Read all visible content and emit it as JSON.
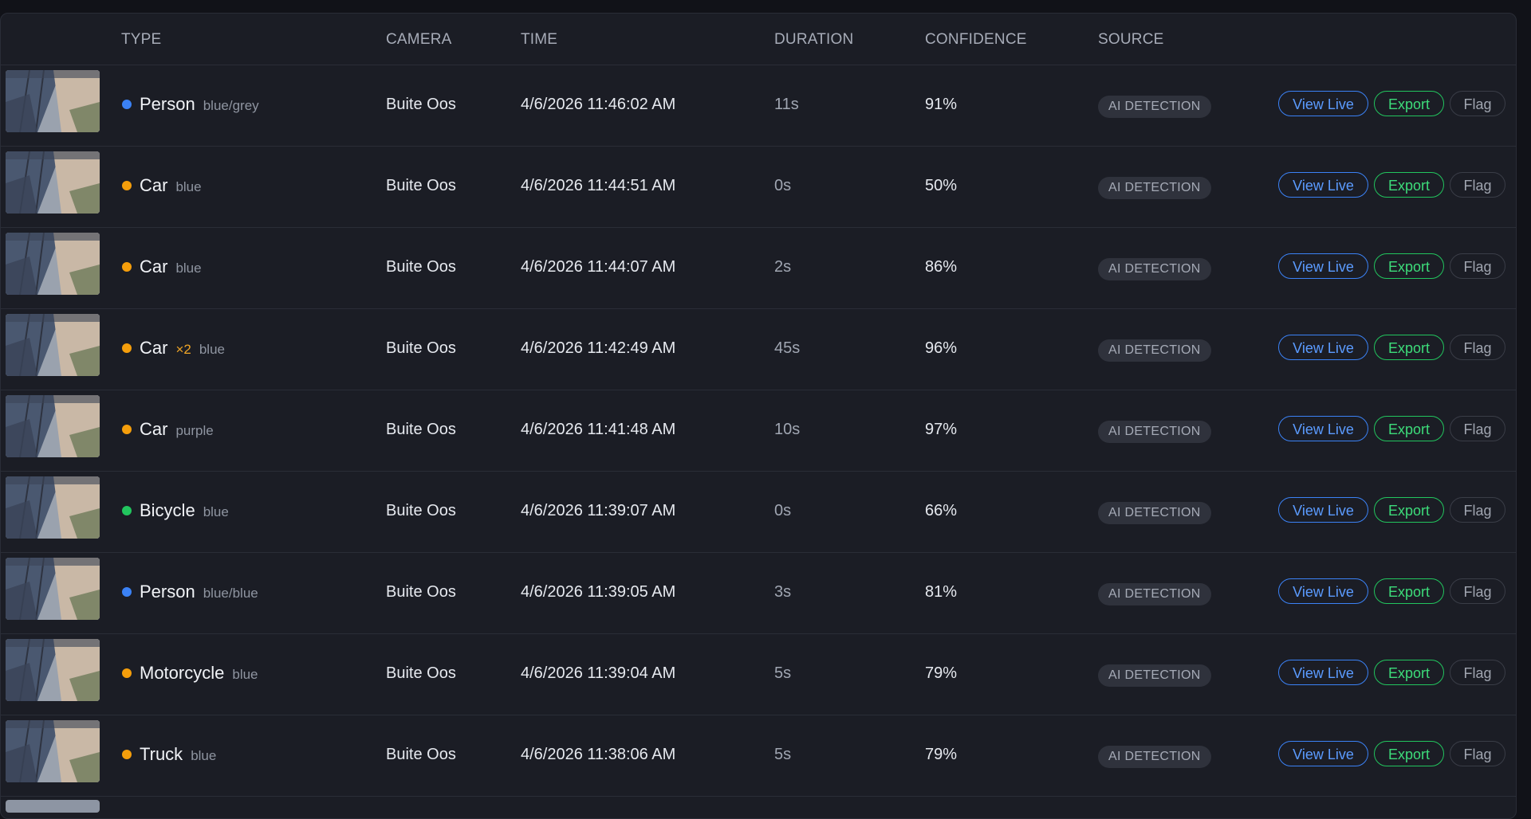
{
  "headers": {
    "type": "TYPE",
    "camera": "CAMERA",
    "time": "TIME",
    "duration": "DURATION",
    "confidence": "CONFIDENCE",
    "source": "SOURCE"
  },
  "colors": {
    "person": "#3b82f6",
    "vehicle": "#f59e0b",
    "bicycle": "#22c55e"
  },
  "rows": [
    {
      "type": "Person",
      "multiplier": "",
      "attr": "blue/grey",
      "dot_color": "#3b82f6",
      "camera": "Buite Oos",
      "time": "4/6/2026 11:46:02 AM",
      "duration": "11s",
      "confidence": "91%",
      "source": "AI DETECTION",
      "view_live": "View Live",
      "export": "Export",
      "flag": "Flag"
    },
    {
      "type": "Car",
      "multiplier": "",
      "attr": "blue",
      "dot_color": "#f59e0b",
      "camera": "Buite Oos",
      "time": "4/6/2026 11:44:51 AM",
      "duration": "0s",
      "confidence": "50%",
      "source": "AI DETECTION",
      "view_live": "View Live",
      "export": "Export",
      "flag": "Flag"
    },
    {
      "type": "Car",
      "multiplier": "",
      "attr": "blue",
      "dot_color": "#f59e0b",
      "camera": "Buite Oos",
      "time": "4/6/2026 11:44:07 AM",
      "duration": "2s",
      "confidence": "86%",
      "source": "AI DETECTION",
      "view_live": "View Live",
      "export": "Export",
      "flag": "Flag"
    },
    {
      "type": "Car",
      "multiplier": "×2",
      "attr": "blue",
      "dot_color": "#f59e0b",
      "camera": "Buite Oos",
      "time": "4/6/2026 11:42:49 AM",
      "duration": "45s",
      "confidence": "96%",
      "source": "AI DETECTION",
      "view_live": "View Live",
      "export": "Export",
      "flag": "Flag"
    },
    {
      "type": "Car",
      "multiplier": "",
      "attr": "purple",
      "dot_color": "#f59e0b",
      "camera": "Buite Oos",
      "time": "4/6/2026 11:41:48 AM",
      "duration": "10s",
      "confidence": "97%",
      "source": "AI DETECTION",
      "view_live": "View Live",
      "export": "Export",
      "flag": "Flag"
    },
    {
      "type": "Bicycle",
      "multiplier": "",
      "attr": "blue",
      "dot_color": "#22c55e",
      "camera": "Buite Oos",
      "time": "4/6/2026 11:39:07 AM",
      "duration": "0s",
      "confidence": "66%",
      "source": "AI DETECTION",
      "view_live": "View Live",
      "export": "Export",
      "flag": "Flag"
    },
    {
      "type": "Person",
      "multiplier": "",
      "attr": "blue/blue",
      "dot_color": "#3b82f6",
      "camera": "Buite Oos",
      "time": "4/6/2026 11:39:05 AM",
      "duration": "3s",
      "confidence": "81%",
      "source": "AI DETECTION",
      "view_live": "View Live",
      "export": "Export",
      "flag": "Flag"
    },
    {
      "type": "Motorcycle",
      "multiplier": "",
      "attr": "blue",
      "dot_color": "#f59e0b",
      "camera": "Buite Oos",
      "time": "4/6/2026 11:39:04 AM",
      "duration": "5s",
      "confidence": "79%",
      "source": "AI DETECTION",
      "view_live": "View Live",
      "export": "Export",
      "flag": "Flag"
    },
    {
      "type": "Truck",
      "multiplier": "",
      "attr": "blue",
      "dot_color": "#f59e0b",
      "camera": "Buite Oos",
      "time": "4/6/2026 11:38:06 AM",
      "duration": "5s",
      "confidence": "79%",
      "source": "AI DETECTION",
      "view_live": "View Live",
      "export": "Export",
      "flag": "Flag"
    }
  ]
}
